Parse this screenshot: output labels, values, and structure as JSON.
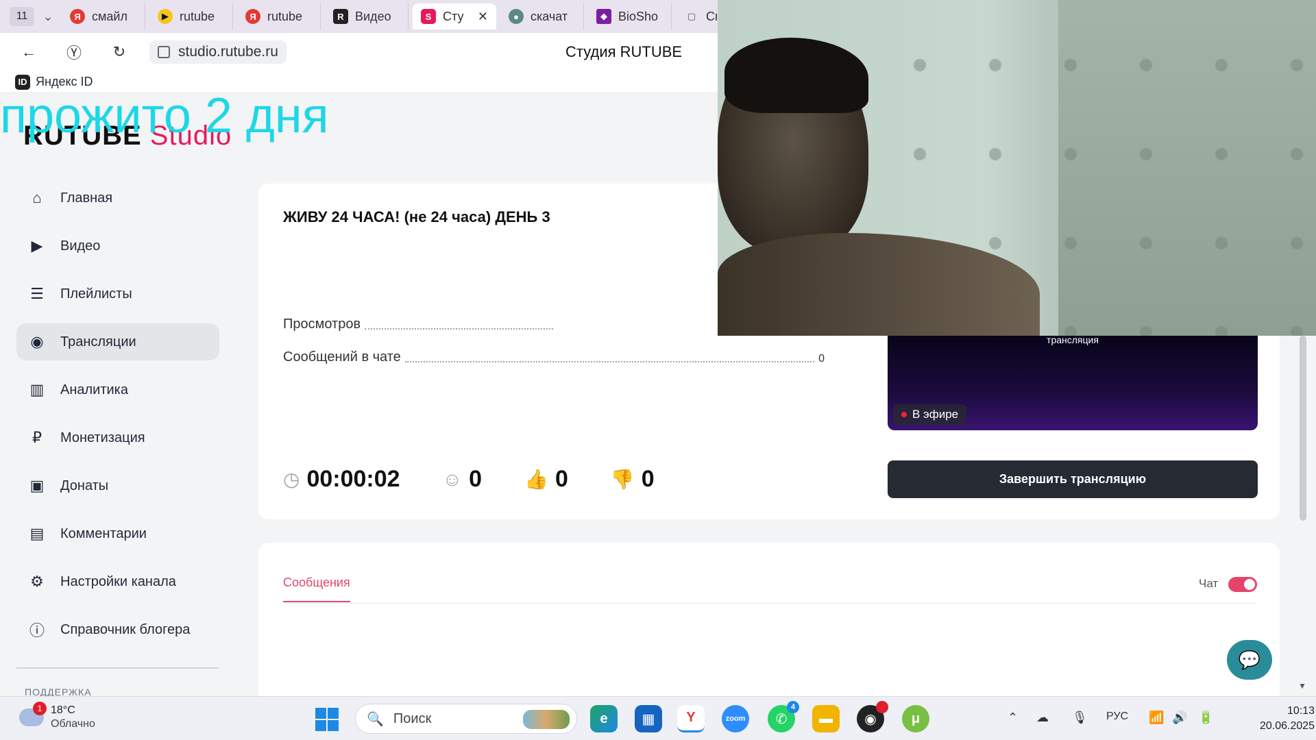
{
  "browser": {
    "tab_count": "11",
    "tabs": [
      {
        "label": "смайл",
        "icon": "Я",
        "color": "#e53935"
      },
      {
        "label": "rutube",
        "icon": "▶",
        "color": "#f5c518"
      },
      {
        "label": "rutube",
        "icon": "Я",
        "color": "#e53935"
      },
      {
        "label": "Видео",
        "icon": "R",
        "color": "#222222"
      },
      {
        "label": "Сту",
        "icon": "S",
        "color": "#e5195c",
        "active": true
      },
      {
        "label": "скачат",
        "icon": "●",
        "color": "#5b8a83"
      },
      {
        "label": "BioSho",
        "icon": "◆",
        "color": "#7b1fa2"
      },
      {
        "label": "Сп",
        "icon": "▢",
        "color": "#666666"
      }
    ],
    "url": "studio.rutube.ru",
    "page_title": "Студия RUTUBE",
    "bookmark": "Яндекс ID"
  },
  "overlay_text": "прожито 2 дня",
  "logo": {
    "part1": "RUTUBE",
    "part2": "Studio"
  },
  "sidebar": {
    "items": [
      {
        "label": "Главная",
        "icon": "home-icon"
      },
      {
        "label": "Видео",
        "icon": "video-icon"
      },
      {
        "label": "Плейлисты",
        "icon": "playlist-icon"
      },
      {
        "label": "Трансляции",
        "icon": "broadcast-icon",
        "active": true
      },
      {
        "label": "Аналитика",
        "icon": "analytics-icon"
      },
      {
        "label": "Монетизация",
        "icon": "ruble-icon"
      },
      {
        "label": "Донаты",
        "icon": "wallet-icon"
      },
      {
        "label": "Комментарии",
        "icon": "comment-icon"
      },
      {
        "label": "Настройки канала",
        "icon": "gear-icon"
      },
      {
        "label": "Справочник блогера",
        "icon": "info-icon"
      }
    ],
    "support_label": "ПОДДЕРЖКА"
  },
  "stream": {
    "title": "ЖИВУ 24 ЧАСА! (не 24 часа) ДЕНЬ 3",
    "views_label": "Просмотров",
    "chat_label": "Сообщений в чате",
    "chat_value": "0",
    "timer": "00:00:02",
    "viewers": "0",
    "likes": "0",
    "dislikes": "0",
    "preview_text": "трансляция",
    "live_label": "В эфире",
    "end_button": "Завершить трансляцию"
  },
  "chat": {
    "tab_label": "Сообщения",
    "toggle_label": "Чат",
    "toggle_on": true
  },
  "taskbar": {
    "weather_temp": "18°C",
    "weather_desc": "Облачно",
    "weather_badge": "1",
    "search_placeholder": "Поиск",
    "whatsapp_badge": "4",
    "language": "РУС",
    "time": "10:13",
    "date": "20.06.2025"
  }
}
